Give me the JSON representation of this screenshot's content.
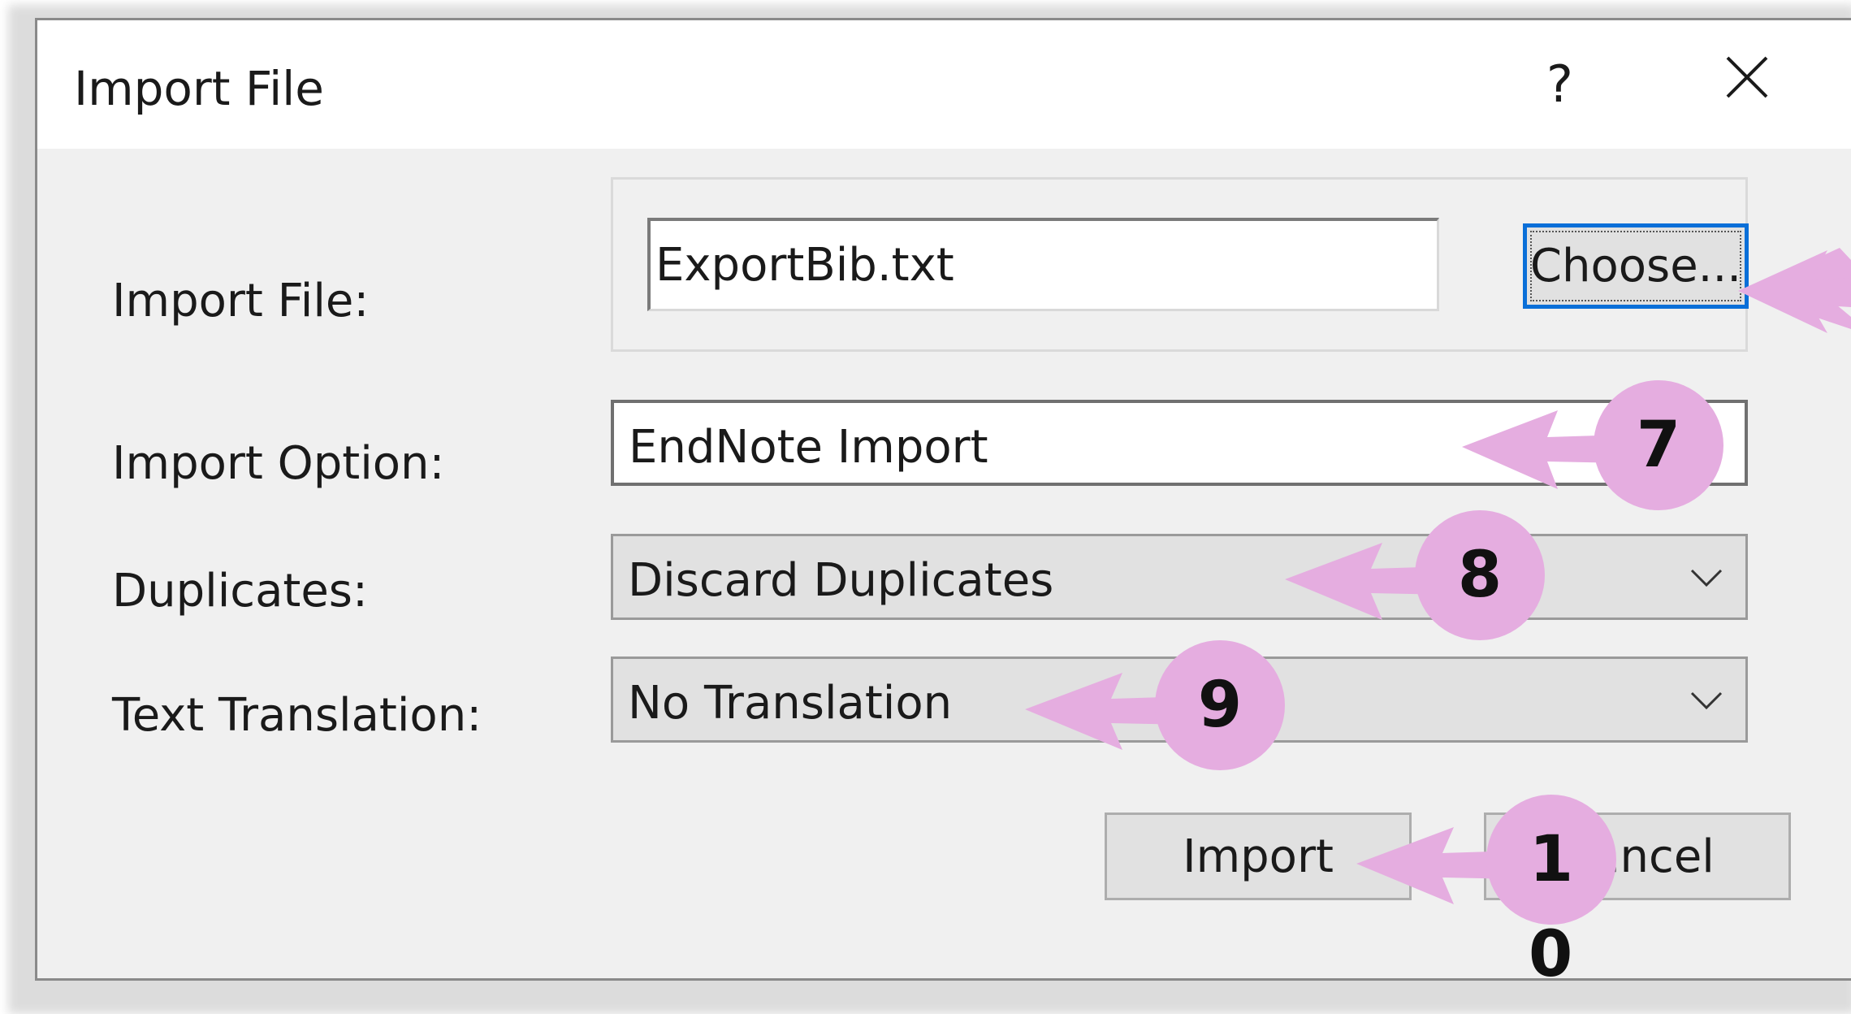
{
  "dialog": {
    "title": "Import File",
    "help_label": "?",
    "close_icon": "close-icon"
  },
  "form": {
    "import_file_label": "Import File:",
    "import_file_value": "ExportBib.txt",
    "choose_button_label": "Choose...",
    "import_option_label": "Import Option:",
    "import_option_value": "EndNote Import",
    "duplicates_label": "Duplicates:",
    "duplicates_value": "Discard Duplicates",
    "text_translation_label": "Text Translation:",
    "text_translation_value": "No Translation"
  },
  "buttons": {
    "import_label": "Import",
    "cancel_label": "Cancel"
  },
  "annotations": {
    "color": "#e5ade0",
    "markers": [
      {
        "label": "7"
      },
      {
        "label": "8"
      },
      {
        "label": "9"
      },
      {
        "label": "1",
        "sublabel": "0"
      }
    ]
  }
}
